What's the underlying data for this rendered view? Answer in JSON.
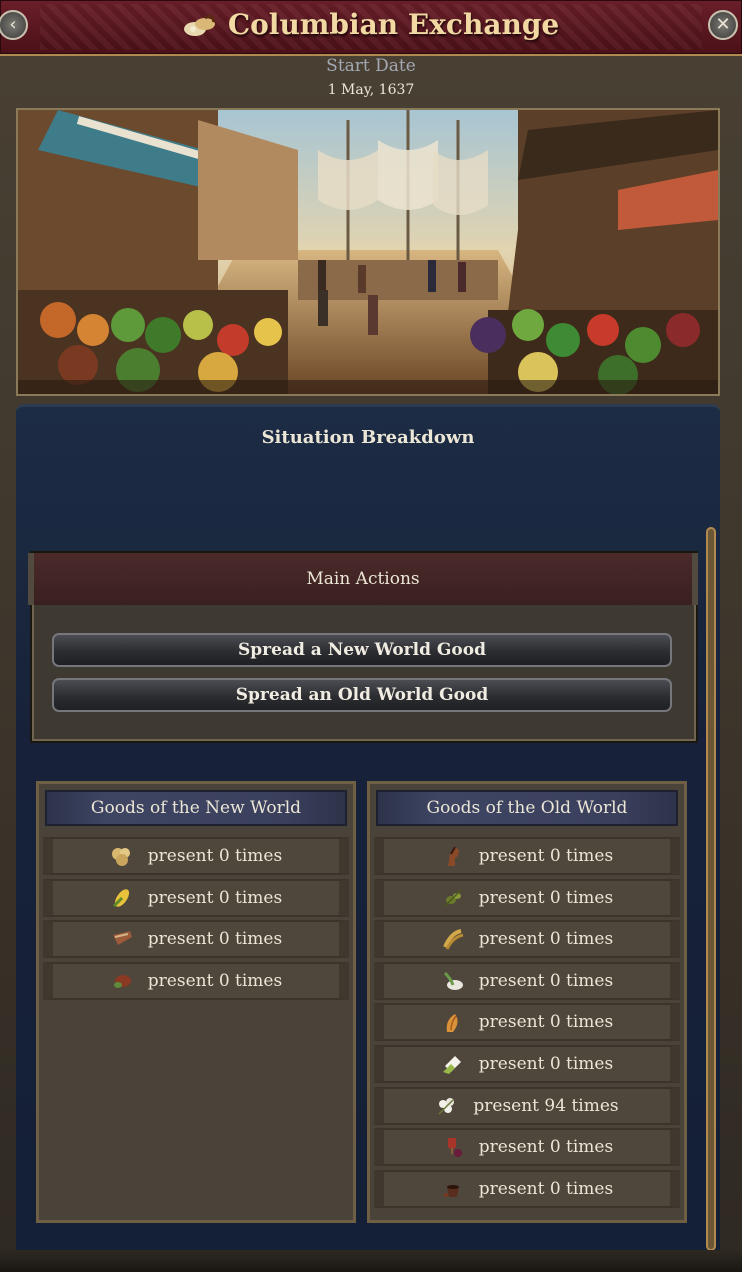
{
  "window": {
    "title": "Columbian Exchange",
    "title_icon": "grain-sack-icon",
    "back_icon": "arrow-left-icon",
    "close_icon": "close-icon",
    "back_symbol": "‹",
    "close_symbol": "✕"
  },
  "start_date": {
    "label": "Start Date",
    "value": "1 May, 1637"
  },
  "illustration": {
    "subject": "market-port-scene"
  },
  "situation": {
    "title": "Situation Breakdown"
  },
  "main_actions": {
    "header": "Main Actions",
    "buttons": [
      {
        "label": "Spread a New World Good"
      },
      {
        "label": "Spread an Old World Good"
      }
    ]
  },
  "new_world": {
    "header": "Goods of the New World",
    "goods": [
      {
        "icon": "potato-icon",
        "text": "present 0 times"
      },
      {
        "icon": "maize-icon",
        "text": "present 0 times"
      },
      {
        "icon": "tobacco-icon",
        "text": "present 0 times"
      },
      {
        "icon": "cocoa-icon",
        "text": "present 0 times"
      }
    ]
  },
  "old_world": {
    "header": "Goods of the Old World",
    "goods": [
      {
        "icon": "horse-icon",
        "text": "present 0 times"
      },
      {
        "icon": "olive-icon",
        "text": "present 0 times"
      },
      {
        "icon": "wheat-icon",
        "text": "present 0 times"
      },
      {
        "icon": "rice-icon",
        "text": "present 0 times"
      },
      {
        "icon": "grain-icon",
        "text": "present 0 times"
      },
      {
        "icon": "sugar-icon",
        "text": "present 0 times"
      },
      {
        "icon": "cotton-icon",
        "text": "present 94 times"
      },
      {
        "icon": "wine-icon",
        "text": "present 0 times"
      },
      {
        "icon": "coffee-icon",
        "text": "present 0 times"
      }
    ]
  },
  "colors": {
    "title_bar": "#5a1620",
    "title_text": "#f2d9a3",
    "panel": "#17223a",
    "accent_gold": "#b08a4e"
  }
}
